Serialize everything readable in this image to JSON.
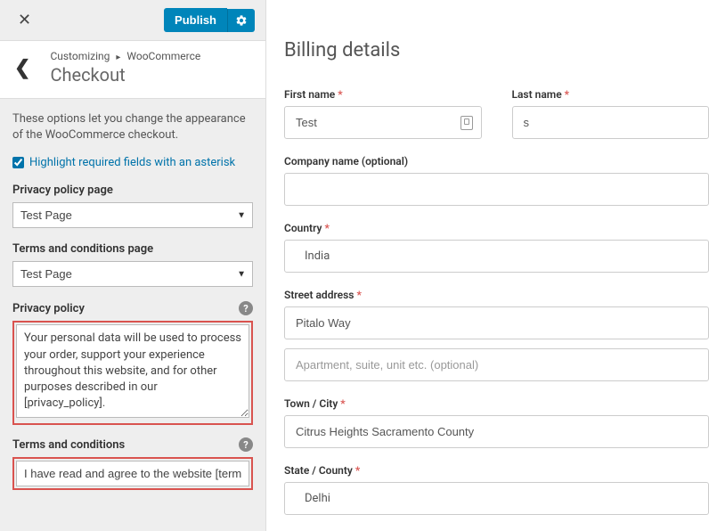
{
  "header": {
    "publish_label": "Publish"
  },
  "breadcrumb": {
    "parent": "Customizing",
    "section": "WooCommerce",
    "title": "Checkout"
  },
  "sidebar": {
    "description": "These options let you change the appearance of the WooCommerce checkout.",
    "highlight_checkbox_label": "Highlight required fields with an asterisk",
    "highlight_checked": true,
    "privacy_page_label": "Privacy policy page",
    "privacy_page_value": "Test Page",
    "terms_page_label": "Terms and conditions page",
    "terms_page_value": "Test Page",
    "privacy_policy_label": "Privacy policy",
    "privacy_policy_text": "Your personal data will be used to process your order, support your experience throughout this website, and for other purposes described in our [privacy_policy].",
    "terms_label": "Terms and conditions",
    "terms_text": "I have read and agree to the website [term"
  },
  "preview": {
    "billing_title": "Billing details",
    "first_name_label": "First name",
    "first_name_value": "Test",
    "last_name_label": "Last name",
    "last_name_value": "s",
    "company_label": "Company name (optional)",
    "company_value": "",
    "country_label": "Country",
    "country_value": "India",
    "street_label": "Street address",
    "street_value": "Pitalo Way",
    "street2_placeholder": "Apartment, suite, unit etc. (optional)",
    "city_label": "Town / City",
    "city_value": "Citrus Heights Sacramento County",
    "state_label": "State / County",
    "state_value": "Delhi"
  }
}
